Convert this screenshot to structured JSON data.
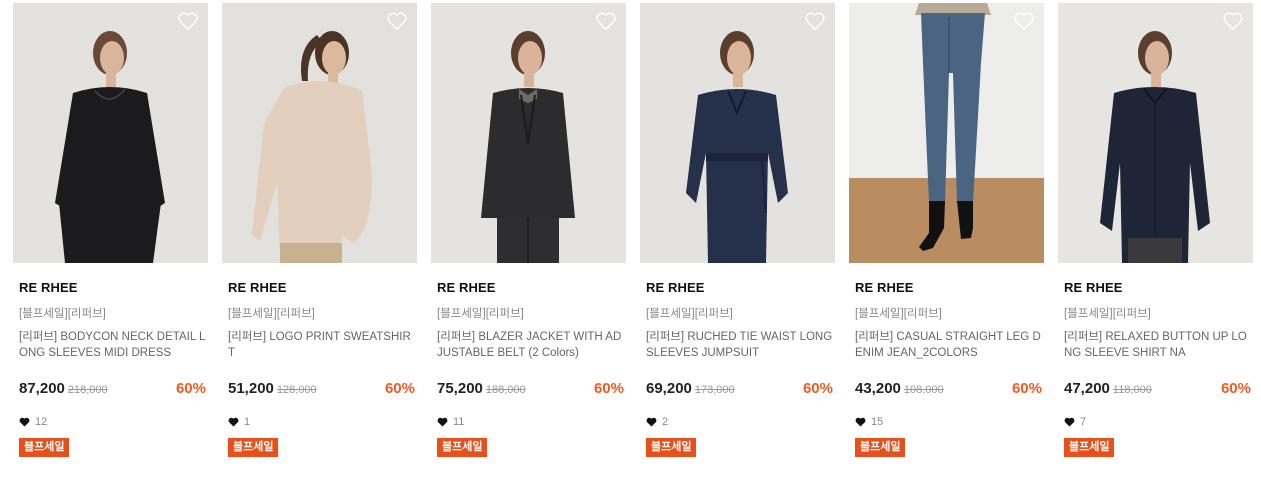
{
  "products": [
    {
      "brand": "RE RHEE",
      "subtitle": "[블프세일][리퍼브]",
      "title": "[리퍼브] BODYCON NECK DETAIL LONG SLEEVES MIDI DRESS",
      "price": "87,200",
      "original_price": "218,000",
      "discount": "60%",
      "likes": "12",
      "badge": "블프세일",
      "image": {
        "bg": "#e3e2df",
        "garment": "#1b1b1d",
        "hair": "#6b4a35",
        "skin": "#d9b59c",
        "style": "dress"
      }
    },
    {
      "brand": "RE RHEE",
      "subtitle": "[블프세일][리퍼브]",
      "title": "[리퍼브] LOGO PRINT SWEATSHIRT",
      "price": "51,200",
      "original_price": "128,000",
      "discount": "60%",
      "likes": "1",
      "badge": "블프세일",
      "image": {
        "bg": "#e2e1de",
        "garment": "#e3cfbe",
        "hair": "#4a3426",
        "skin": "#dcb89d",
        "style": "sweatshirt"
      }
    },
    {
      "brand": "RE RHEE",
      "subtitle": "[블프세일][리퍼브]",
      "title": "[리퍼브] BLAZER JACKET WITH ADJUSTABLE BELT (2 Colors)",
      "price": "75,200",
      "original_price": "188,000",
      "discount": "60%",
      "likes": "11",
      "badge": "블프세일",
      "image": {
        "bg": "#e4e3e0",
        "garment": "#2c2c2e",
        "hair": "#5a3f2d",
        "skin": "#d9b49a",
        "style": "blazer"
      }
    },
    {
      "brand": "RE RHEE",
      "subtitle": "[블프세일][리퍼브]",
      "title": "[리퍼브] RUCHED TIE WAIST LONG SLEEVES JUMPSUIT",
      "price": "69,200",
      "original_price": "173,000",
      "discount": "60%",
      "likes": "2",
      "badge": "블프세일",
      "image": {
        "bg": "#e3e2df",
        "garment": "#25304a",
        "hair": "#5a3f2d",
        "skin": "#dab59a",
        "style": "jumpsuit"
      }
    },
    {
      "brand": "RE RHEE",
      "subtitle": "[블프세일][리퍼브]",
      "title": "[리퍼브] CASUAL STRAIGHT LEG DENIM JEAN_2COLORS",
      "price": "43,200",
      "original_price": "108,000",
      "discount": "60%",
      "likes": "15",
      "badge": "블프세일",
      "image": {
        "bg": "#ededeb",
        "garment": "#4b6482",
        "hair": "#000000",
        "skin": "#d4b29a",
        "style": "jeans"
      }
    },
    {
      "brand": "RE RHEE",
      "subtitle": "[블프세일][리퍼브]",
      "title": "[리퍼브] RELAXED BUTTON UP LONG SLEEVE SHIRT NA",
      "price": "47,200",
      "original_price": "118,000",
      "discount": "60%",
      "likes": "7",
      "badge": "블프세일",
      "image": {
        "bg": "#e6e5e2",
        "garment": "#1e2536",
        "hair": "#5a3f2d",
        "skin": "#d9b49a",
        "style": "shirt"
      }
    }
  ],
  "colors": {
    "discount": "#f15a24",
    "badge_bg": "#e8501b",
    "badge_text": "#ffffff",
    "price": "#222222",
    "muted": "#888888"
  },
  "icons": {
    "wishlist": "heart-outline-icon",
    "likes": "heart-filled-icon"
  }
}
